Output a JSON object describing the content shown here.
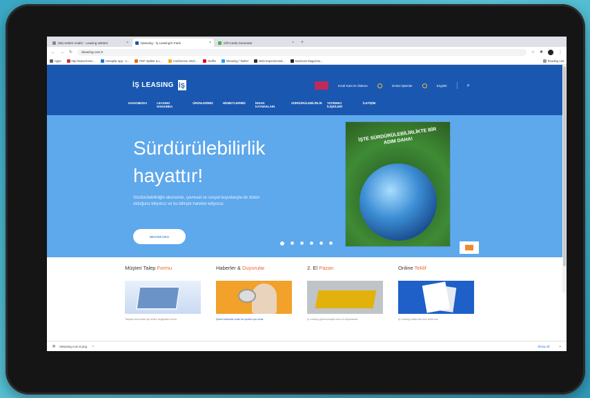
{
  "browser": {
    "tabs": [
      {
        "label": "(55) Sektör Analizi - Leasing sektörü",
        "active": false
      },
      {
        "label": "İşleasing - İş Leasing'in Farkı",
        "active": true
      },
      {
        "label": "Gift Cards Generator",
        "active": false
      }
    ],
    "url": "isleasing.com.tr",
    "bookmarks": [
      "Apps",
      "http://www.home...",
      "Hesaplar app - s...",
      "PDF Splitter & L...",
      "Conference 2021...",
      "Netflix",
      "İsleasing / Twitter",
      "Web Experimental...",
      "Business Magazine..."
    ],
    "reading_list": "Reading List"
  },
  "site": {
    "logo": "İŞ LEASING",
    "logo_mark": "İŞ",
    "top_links": [
      "Kredi Kartı ile Ödeme",
      "Online İşlemler",
      "English"
    ],
    "nav": [
      "HAKKIMIZDA",
      "LEASING HAKKINDA",
      "ÜRÜNLERİMİZ",
      "HİZMETLERİMİZ",
      "İNSAN KAYNAKLARI",
      "SÜRDÜRÜLEBİLİRLİK",
      "YATIRIMCI İLİŞKİLERİ",
      "İLETİŞİM"
    ],
    "hero": {
      "title1": "Sürdürülebilirlik",
      "title2": "hayattır!",
      "body": "Sürdürülebilirliğin ekonomik, çevresel ve sosyal boyutlarıyla bir bütün olduğunu biliyoruz ve bu bilinçle hareket ediyoruz.",
      "button": "DEVAMI OKU",
      "poster_caption": "İŞTE SÜRDÜRÜLEBİLİRLİKTE BİR ADIM DAHA!"
    },
    "cards": [
      {
        "title_a": "Müşteri Talep",
        "title_b": "Formu",
        "line": "Talepte bulunmak için lütfen aşağıdaki formu"
      },
      {
        "title_a": "Haberler &",
        "title_b": "Duyurular",
        "line": "Şirket ekibimizi ortak bir çözüm için ortak"
      },
      {
        "title_a": "2. El",
        "title_b": "Pazarı",
        "line": "İş Leasing güvencesiyle ikinci el ekipmanlar"
      },
      {
        "title_a": "Online",
        "title_b": "Teklif",
        "line": "İş Leasing hakkında hızlı teklif alın"
      }
    ]
  },
  "download_bar": {
    "file": "isleasing.com.tr.png",
    "show_all": "Show All"
  }
}
